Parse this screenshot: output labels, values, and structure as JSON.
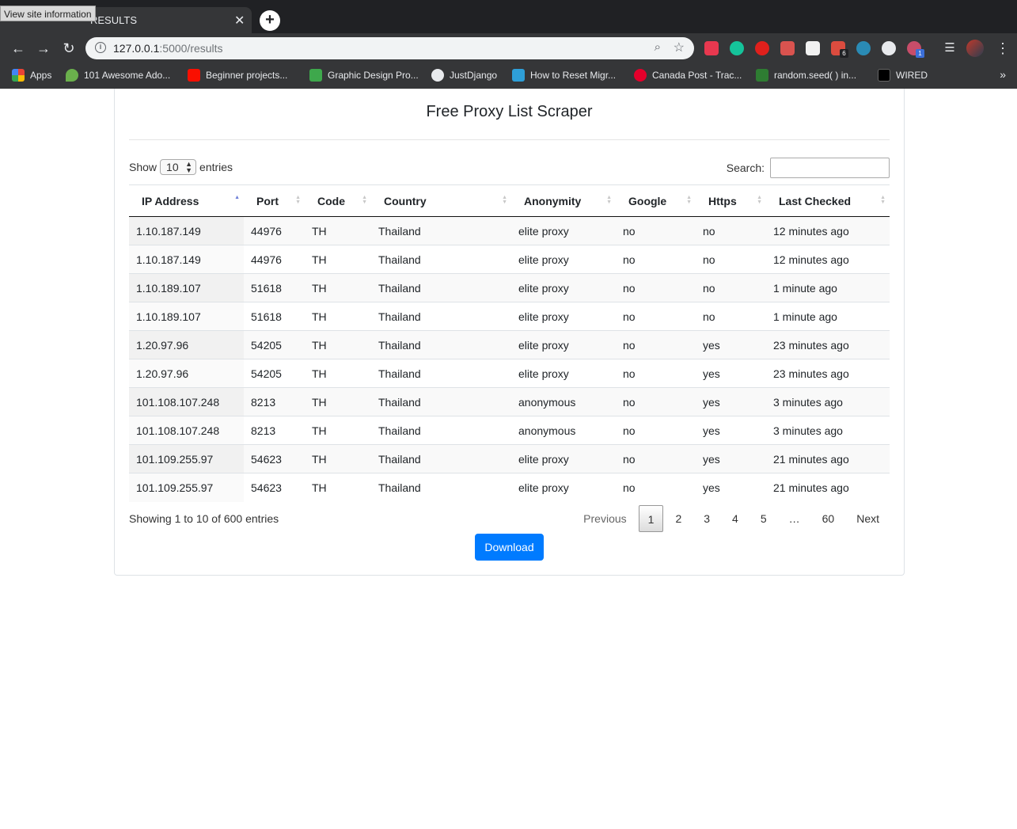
{
  "browser": {
    "tab_title": "RESULTS",
    "tooltip": "View site information",
    "url_host": "127.0.0.1",
    "url_rest": ":5000/results",
    "extension_badges": [
      "6",
      "1"
    ],
    "bookmarks": [
      "Apps",
      "101 Awesome Ado...",
      "Beginner projects...",
      "Graphic Design Pro...",
      "JustDjango",
      "How to Reset Migr...",
      "Canada Post - Trac...",
      "random.seed( ) in...",
      "WIRED"
    ],
    "more_bookmarks": "»"
  },
  "page": {
    "title": "Free Proxy List Scraper",
    "length_label_before": "Show",
    "length_value": "10",
    "length_label_after": "entries",
    "search_label": "Search:",
    "search_value": "",
    "columns": [
      "IP Address",
      "Port",
      "Code",
      "Country",
      "Anonymity",
      "Google",
      "Https",
      "Last Checked"
    ],
    "sorted_column": "IP Address",
    "sort_direction": "ascending",
    "rows": [
      [
        "1.10.187.149",
        "44976",
        "TH",
        "Thailand",
        "elite proxy",
        "no",
        "no",
        "12 minutes ago"
      ],
      [
        "1.10.187.149",
        "44976",
        "TH",
        "Thailand",
        "elite proxy",
        "no",
        "no",
        "12 minutes ago"
      ],
      [
        "1.10.189.107",
        "51618",
        "TH",
        "Thailand",
        "elite proxy",
        "no",
        "no",
        "1 minute ago"
      ],
      [
        "1.10.189.107",
        "51618",
        "TH",
        "Thailand",
        "elite proxy",
        "no",
        "no",
        "1 minute ago"
      ],
      [
        "1.20.97.96",
        "54205",
        "TH",
        "Thailand",
        "elite proxy",
        "no",
        "yes",
        "23 minutes ago"
      ],
      [
        "1.20.97.96",
        "54205",
        "TH",
        "Thailand",
        "elite proxy",
        "no",
        "yes",
        "23 minutes ago"
      ],
      [
        "101.108.107.248",
        "8213",
        "TH",
        "Thailand",
        "anonymous",
        "no",
        "yes",
        "3 minutes ago"
      ],
      [
        "101.108.107.248",
        "8213",
        "TH",
        "Thailand",
        "anonymous",
        "no",
        "yes",
        "3 minutes ago"
      ],
      [
        "101.109.255.97",
        "54623",
        "TH",
        "Thailand",
        "elite proxy",
        "no",
        "yes",
        "21 minutes ago"
      ],
      [
        "101.109.255.97",
        "54623",
        "TH",
        "Thailand",
        "elite proxy",
        "no",
        "yes",
        "21 minutes ago"
      ]
    ],
    "info": "Showing 1 to 10 of 600 entries",
    "pagination": {
      "previous": "Previous",
      "pages": [
        "1",
        "2",
        "3",
        "4",
        "5",
        "…",
        "60"
      ],
      "current": "1",
      "next": "Next"
    },
    "download_label": "Download",
    "colors": {
      "primary": "#007bff",
      "chrome_bg": "#353638",
      "tabstrip_bg": "#202124"
    }
  }
}
